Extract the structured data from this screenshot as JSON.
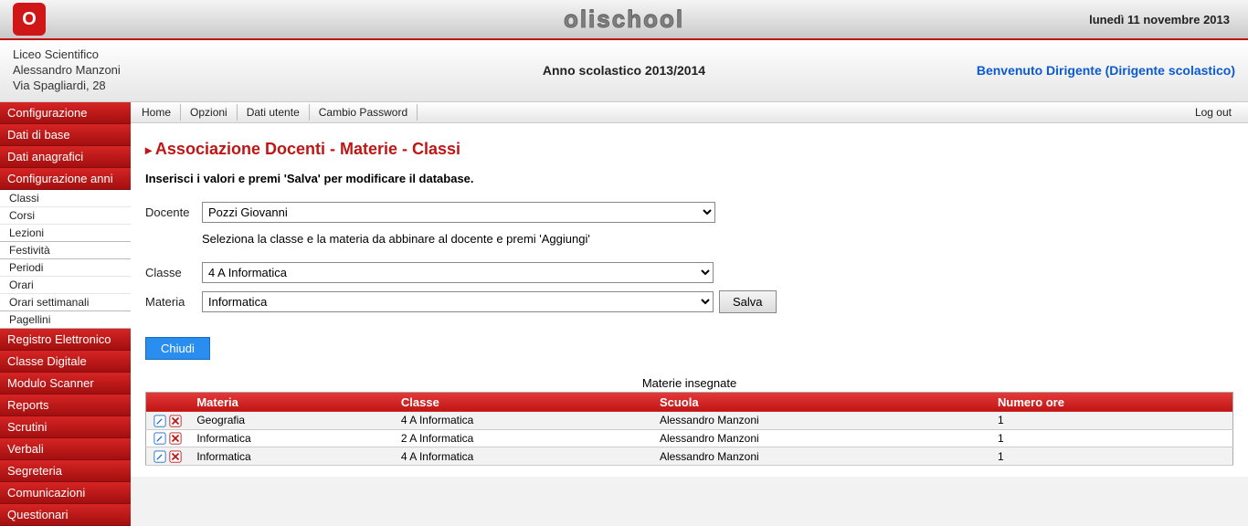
{
  "header": {
    "brand": "olischool",
    "date": "lunedì 11 novembre 2013",
    "school_name": "Liceo Scientifico",
    "school_sub": "Alessandro Manzoni",
    "school_addr": "Via Spagliardi, 28",
    "year": "Anno scolastico 2013/2014",
    "welcome": "Benvenuto Dirigente (Dirigente scolastico)"
  },
  "menubar": {
    "items": [
      "Home",
      "Opzioni",
      "Dati utente",
      "Cambio Password"
    ],
    "logout": "Log out"
  },
  "sidebar": [
    {
      "type": "section",
      "label": "Configurazione"
    },
    {
      "type": "section",
      "label": "Dati di base"
    },
    {
      "type": "section",
      "label": "Dati anagrafici"
    },
    {
      "type": "section",
      "label": "Configurazione anni"
    },
    {
      "type": "item",
      "label": "Classi"
    },
    {
      "type": "item",
      "label": "Corsi"
    },
    {
      "type": "item",
      "label": "Lezioni",
      "sep": true
    },
    {
      "type": "item",
      "label": "Festività",
      "sep": true
    },
    {
      "type": "item",
      "label": "Periodi"
    },
    {
      "type": "item",
      "label": "Orari"
    },
    {
      "type": "item",
      "label": "Orari settimanali",
      "sep": true
    },
    {
      "type": "item",
      "label": "Pagellini",
      "sep": true
    },
    {
      "type": "section",
      "label": "Registro Elettronico"
    },
    {
      "type": "section",
      "label": "Classe Digitale"
    },
    {
      "type": "section",
      "label": "Modulo Scanner"
    },
    {
      "type": "section",
      "label": "Reports"
    },
    {
      "type": "section",
      "label": "Scrutini"
    },
    {
      "type": "section",
      "label": "Verbali"
    },
    {
      "type": "section",
      "label": "Segreteria"
    },
    {
      "type": "section",
      "label": "Comunicazioni"
    },
    {
      "type": "section",
      "label": "Questionari"
    }
  ],
  "page": {
    "title": "Associazione Docenti - Materie - Classi",
    "instructions": "Inserisci i valori e premi 'Salva' per modificare il database.",
    "docente_label": "Docente",
    "docente_value": "Pozzi Giovanni",
    "sub_note": "Seleziona la classe e la materia da abbinare al docente e premi 'Aggiungi'",
    "classe_label": "Classe",
    "classe_value": "4 A Informatica",
    "materia_label": "Materia",
    "materia_value": "Informatica",
    "save_label": "Salva",
    "close_label": "Chiudi",
    "table_caption": "Materie insegnate",
    "columns": [
      "Materia",
      "Classe",
      "Scuola",
      "Numero ore"
    ],
    "rows": [
      {
        "materia": "Geografia",
        "classe": "4 A Informatica",
        "scuola": "Alessandro Manzoni",
        "ore": "1"
      },
      {
        "materia": "Informatica",
        "classe": "2 A Informatica",
        "scuola": "Alessandro Manzoni",
        "ore": "1"
      },
      {
        "materia": "Informatica",
        "classe": "4 A Informatica",
        "scuola": "Alessandro Manzoni",
        "ore": "1"
      }
    ]
  }
}
